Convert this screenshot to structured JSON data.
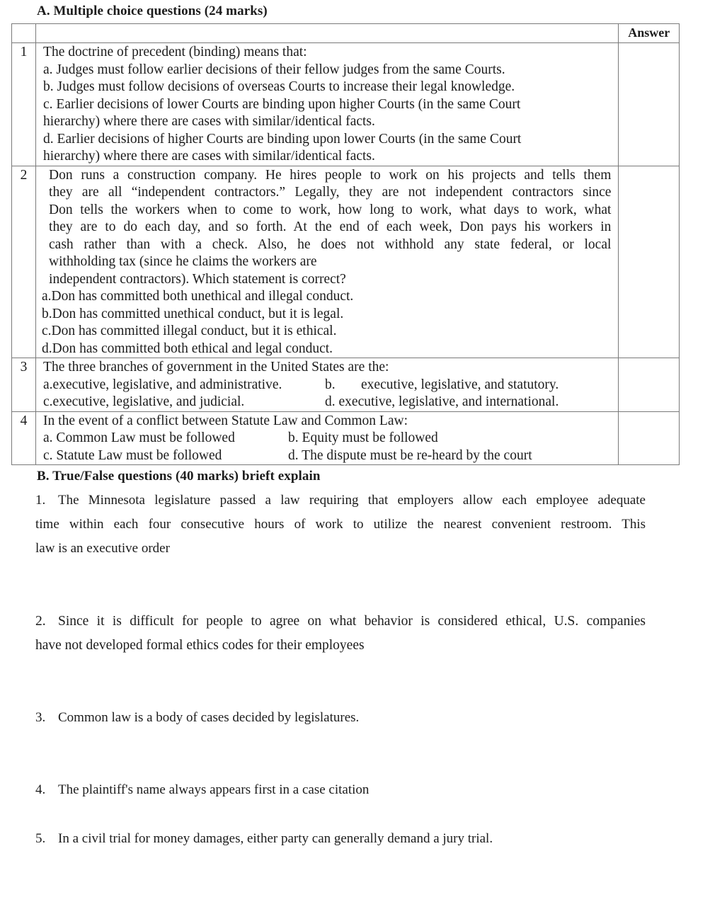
{
  "section_a": {
    "heading": "A. Multiple choice questions (24 marks)",
    "answer_header": "Answer",
    "questions": [
      {
        "number": "1",
        "stem_lines": [
          "The doctrine of precedent (binding) means that:"
        ],
        "option_lines": [
          "a. Judges must follow earlier decisions of their fellow judges from the same Courts.",
          "b. Judges must follow decisions of overseas Courts to increase their legal knowledge.",
          "c. Earlier decisions of lower Courts are binding upon higher Courts (in the same Court",
          "hierarchy) where there are cases with similar/identical facts.",
          "d. Earlier decisions of higher Courts are binding upon lower Courts (in the same Court",
          "hierarchy) where there are cases with similar/identical facts."
        ],
        "answer": ""
      },
      {
        "number": "2",
        "stem_lines": [
          "Don runs a construction company.  He hires people to work on his projects and tells them",
          "they are all “independent contractors.”  Legally, they are not independent contractors since",
          "Don tells the workers when to come to work, how long to work, what days to work, what",
          "they are to do each day, and so forth.  At the end of each week, Don pays his workers in",
          "cash rather than with a check. Also, he does not withhold any state federal, or local",
          "withholding tax (since he claims the workers are",
          "independent contractors).  Which statement is correct?"
        ],
        "option_lines": [
          "a.Don has committed both unethical and illegal conduct.",
          "b.Don has committed unethical conduct, but it is legal.",
          "c.Don has committed illegal conduct, but it is ethical.",
          "d.Don has committed both ethical and legal conduct."
        ],
        "answer": ""
      },
      {
        "number": "3",
        "stem_lines": [
          "The three branches of government in the United States are the:"
        ],
        "options": {
          "a": "a.executive, legislative, and administrative.",
          "b_label": "b.",
          "b": "executive, legislative, and statutory.",
          "c": "c.executive, legislative, and judicial.",
          "d": "d. executive, legislative, and international."
        },
        "answer": ""
      },
      {
        "number": "4",
        "stem_lines": [
          "In the event of a conflict between Statute Law and Common Law:"
        ],
        "options": {
          "a": "a. Common Law must be followed",
          "b": "b. Equity must be followed",
          "c": "c. Statute Law must be followed",
          "d": "d. The dispute must be re-heard by the court"
        },
        "answer": ""
      }
    ]
  },
  "section_b": {
    "heading": "B. True/False questions (40 marks) brieft explain",
    "items": [
      {
        "number": "1.",
        "lines": [
          "The Minnesota legislature passed a law requiring that employers allow each employee adequate",
          "time within each four consecutive hours of work to utilize the nearest convenient restroom.  This",
          "law is an executive order"
        ]
      },
      {
        "number": "2.",
        "lines": [
          "Since it is difficult for people to agree on what behavior is considered ethical, U.S. companies",
          "have not developed formal ethics codes for their employees"
        ]
      },
      {
        "number": "3.",
        "lines": [
          "Common law is a body of cases decided by legislatures."
        ]
      },
      {
        "number": "4.",
        "lines": [
          "The plaintiff's name always appears first in a case citation"
        ]
      },
      {
        "number": "5.",
        "lines": [
          "In a civil trial for money damages, either party can generally demand a jury trial."
        ]
      }
    ]
  }
}
